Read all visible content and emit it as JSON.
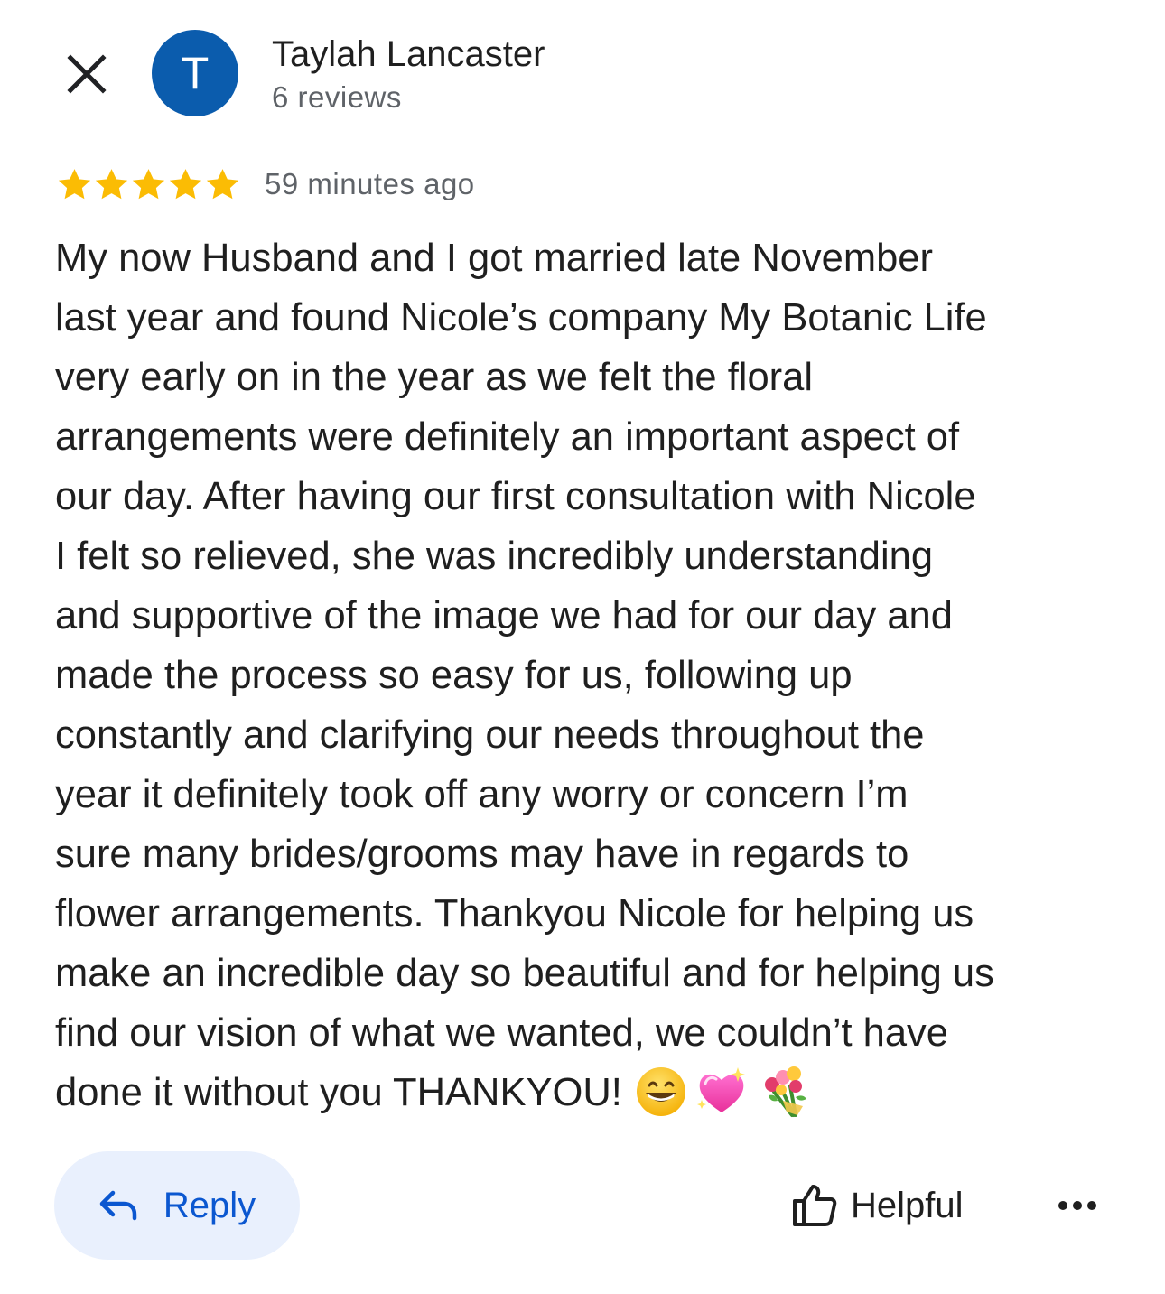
{
  "header": {
    "close_icon": "close-icon",
    "avatar_initial": "T",
    "avatar_color": "#0b5cad",
    "reviewer_name": "Taylah Lancaster",
    "review_count": "6 reviews"
  },
  "rating": {
    "stars": 5,
    "max_stars": 5,
    "star_color": "#fbbc04",
    "time_ago": "59 minutes ago"
  },
  "review": {
    "lines": [
      "My now Husband and I got married late November",
      "last year and found Nicole’s company My Botanic Life",
      "very early on in the year as we felt the floral",
      "arrangements were definitely an important aspect of",
      "our day. After having our first consultation with Nicole",
      "I felt so relieved, she was incredibly understanding",
      "and supportive of the image we had for our day and",
      "made the process so easy for us, following up",
      "constantly and clarifying our needs throughout the",
      "year it definitely took off any worry or concern I’m",
      "sure many brides/grooms may have in regards to",
      "flower arrangements. Thankyou Nicole for helping us",
      "make an incredible day so beautiful and for helping us",
      "find our vision of what we wanted, we couldn’t have",
      "done it without you THANKYOU!"
    ],
    "emojis": [
      "grinning-face-emoji",
      "sparkling-heart-emoji",
      "bouquet-emoji"
    ]
  },
  "actions": {
    "reply_label": "Reply",
    "reply_icon": "reply-arrow-icon",
    "reply_bg": "#e9f0fd",
    "accent_color": "#0b57d0",
    "helpful_label": "Helpful",
    "helpful_icon": "thumbs-up-icon",
    "more_icon": "more-horizontal-icon"
  }
}
